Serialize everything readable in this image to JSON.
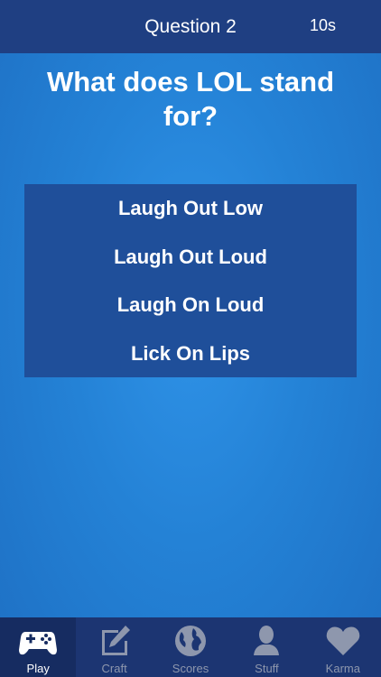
{
  "header": {
    "title": "Question 2",
    "timer": "10s"
  },
  "question": {
    "text": "What does LOL stand for?"
  },
  "answers": [
    "Laugh Out Low",
    "Laugh Out Loud",
    "Laugh On Loud",
    "Lick On Lips"
  ],
  "tabs": [
    {
      "label": "Play",
      "icon": "gamepad-icon",
      "active": true
    },
    {
      "label": "Craft",
      "icon": "pencil-icon",
      "active": false
    },
    {
      "label": "Scores",
      "icon": "globe-icon",
      "active": false
    },
    {
      "label": "Stuff",
      "icon": "person-icon",
      "active": false
    },
    {
      "label": "Karma",
      "icon": "heart-icon",
      "active": false
    }
  ],
  "colors": {
    "header": "#1f3f82",
    "background": "#2482d6",
    "answers_panel": "#1f4f9a",
    "tabbar": "#1c3572"
  }
}
